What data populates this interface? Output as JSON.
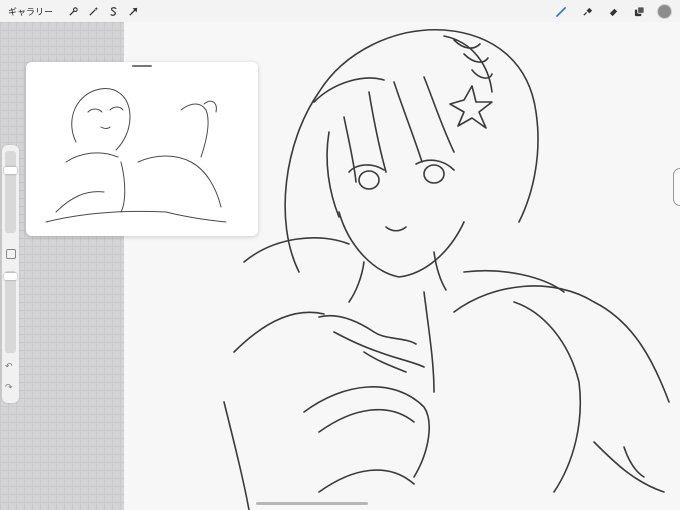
{
  "toolbar": {
    "gallery_label": "ギャラリー",
    "left_tools": [
      "wrench-icon",
      "magic-wand-icon",
      "selection-s-icon",
      "transform-arrow-icon"
    ],
    "right_tools": [
      "brush-icon",
      "smudge-icon",
      "eraser-icon",
      "layers-icon"
    ],
    "color": "#8c8c8c",
    "accent": "#2b6fe6"
  },
  "sidebar": {
    "undo_icon": "↶",
    "redo_icon": "↷"
  }
}
